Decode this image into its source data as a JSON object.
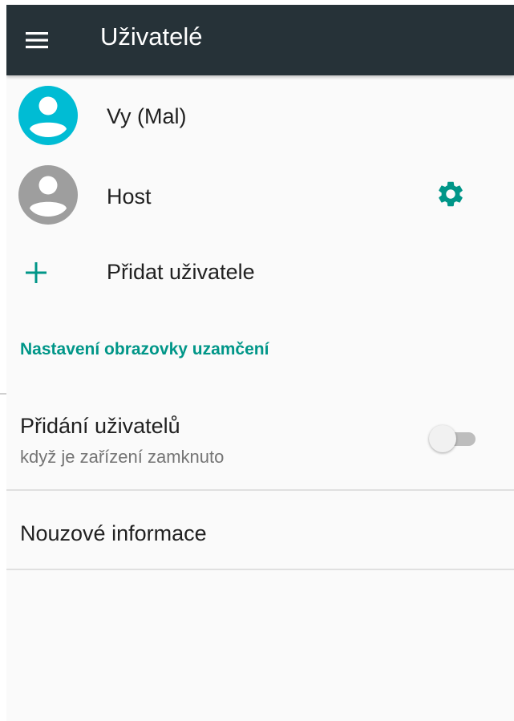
{
  "app_bar": {
    "title": "Uživatelé",
    "menu_icon": "hamburger-menu-icon",
    "background_color": "#263238"
  },
  "users": [
    {
      "label": "Vy (Mal)",
      "avatar_color": "#00bcd4",
      "icon": "person-avatar-icon"
    },
    {
      "label": "Host",
      "avatar_color": "#9e9e9e",
      "icon": "person-avatar-icon",
      "settings_icon": "gear-icon"
    }
  ],
  "add_user": {
    "label": "Přidat uživatele",
    "icon": "plus-icon"
  },
  "lock_screen_section": {
    "header": "Nastavení obrazovky uzamčení",
    "add_users_pref": {
      "title": "Přidání uživatelů",
      "summary": "když je zařízení zamknuto",
      "enabled": false
    }
  },
  "emergency_info": {
    "title": "Nouzové informace"
  },
  "colors": {
    "accent": "#009688",
    "text_primary": "#212121",
    "text_secondary": "#757575"
  }
}
